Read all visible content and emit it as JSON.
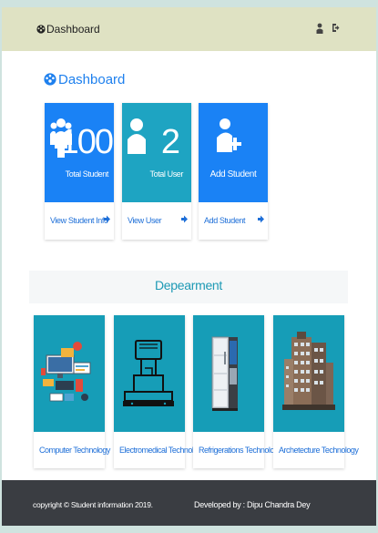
{
  "navbar": {
    "brand_label": "Dashboard",
    "icons": [
      "dashboard-icon",
      "user-icon",
      "logout-icon"
    ]
  },
  "page": {
    "title": "Dashboard"
  },
  "cards": [
    {
      "number": "100",
      "caption": "Total Student",
      "footer": "View Student Info",
      "color": "#1a82f5",
      "icon": "users-icon"
    },
    {
      "number": "2",
      "caption": "Total User",
      "footer": "View User",
      "color": "#1ea4c2",
      "icon": "user-icon"
    },
    {
      "number": "",
      "caption": "Add Student",
      "footer": "Add Student",
      "color": "#1a82f5",
      "icon": "add-user-icon"
    }
  ],
  "department": {
    "heading": "Depearment",
    "items": [
      {
        "label": "Computer Technology",
        "image": "computer-illustration"
      },
      {
        "label": "Electromedical Technology",
        "image": "electromedical-machine"
      },
      {
        "label": "Refrigerations Technology",
        "image": "refrigerator"
      },
      {
        "label": "Archetecture Technology",
        "image": "building"
      }
    ]
  },
  "footer": {
    "copyright": "copyright © Student information 2019.",
    "developer": "Developed by : Dipu Chandra Dey"
  },
  "colors": {
    "navbar_bg": "#dfe2c3",
    "accent": "#1a82f5",
    "teal": "#1ea4c2",
    "footer_bg": "#3a3d42"
  }
}
